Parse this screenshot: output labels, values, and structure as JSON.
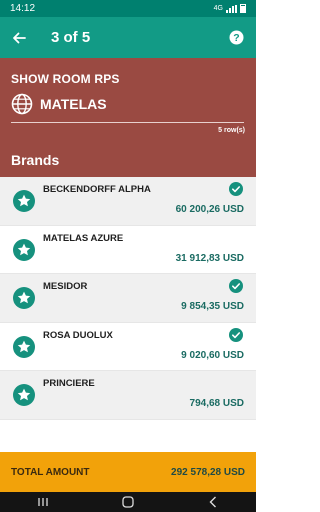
{
  "status_bar": {
    "time": "14:12",
    "network": "4G"
  },
  "app_bar": {
    "title": "3 of 5",
    "back_icon": "arrow-left-icon",
    "help_icon": "help-circle-icon"
  },
  "store": {
    "label": "SHOW ROOM RPS",
    "icon": "globe-icon",
    "name": "MATELAS",
    "row_count": "5 row(s)",
    "section_title": "Brands"
  },
  "brands": [
    {
      "name": "BECKENDORFF ALPHA",
      "amount": "60 200,26 USD",
      "checked": true
    },
    {
      "name": "MATELAS AZURE",
      "amount": "31 912,83 USD",
      "checked": false
    },
    {
      "name": "MESIDOR",
      "amount": "9 854,35 USD",
      "checked": true
    },
    {
      "name": "ROSA DUOLUX",
      "amount": "9 020,60 USD",
      "checked": true
    },
    {
      "name": "PRINCIERE",
      "amount": "794,68 USD",
      "checked": false
    }
  ],
  "footer": {
    "label": "TOTAL AMOUNT",
    "value": "292 578,28 USD"
  },
  "colors": {
    "status_bar": "#00806f",
    "app_bar": "#129b86",
    "header": "#9a4a42",
    "accent": "#16917e",
    "total_bar": "#f2a20a"
  }
}
